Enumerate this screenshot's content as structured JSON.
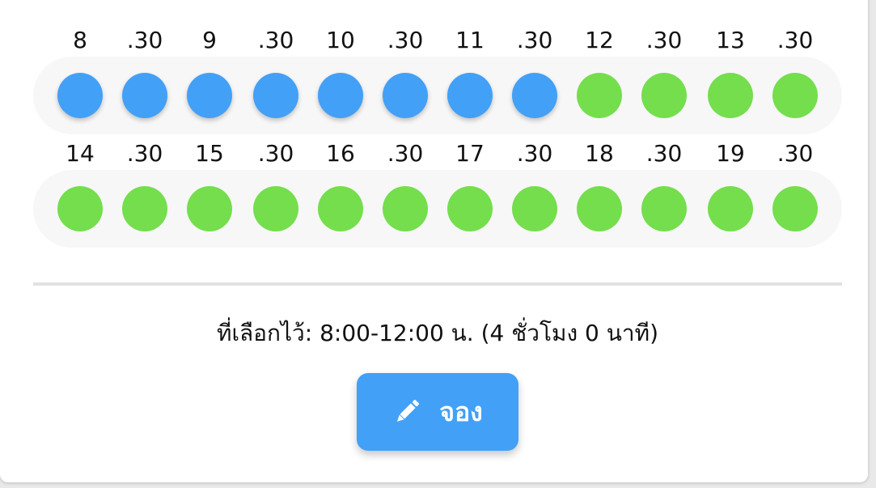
{
  "colors": {
    "selected": "#42a0f7",
    "available": "#74de4d",
    "button": "#42a0f7"
  },
  "rows": [
    {
      "labels": [
        "8",
        ".30",
        "9",
        ".30",
        "10",
        ".30",
        "11",
        ".30",
        "12",
        ".30",
        "13",
        ".30"
      ],
      "slots": [
        "selected",
        "selected",
        "selected",
        "selected",
        "selected",
        "selected",
        "selected",
        "selected",
        "available",
        "available",
        "available",
        "available"
      ]
    },
    {
      "labels": [
        "14",
        ".30",
        "15",
        ".30",
        "16",
        ".30",
        "17",
        ".30",
        "18",
        ".30",
        "19",
        ".30"
      ],
      "slots": [
        "available",
        "available",
        "available",
        "available",
        "available",
        "available",
        "available",
        "available",
        "available",
        "available",
        "available",
        "available"
      ]
    }
  ],
  "summary": "ที่เลือกไว้: 8:00-12:00 น. (4 ชั่วโมง 0 นาที)",
  "book_button": {
    "label": "จอง",
    "icon": "pencil-icon"
  }
}
